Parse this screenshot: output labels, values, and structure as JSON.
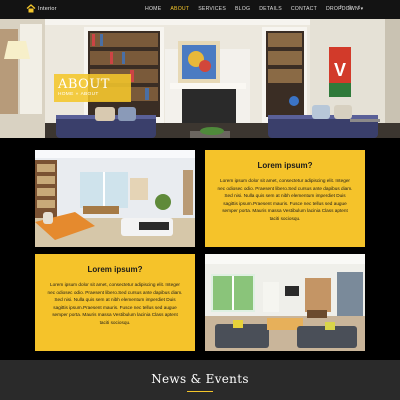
{
  "nav": {
    "logo_text": "Interior",
    "items": [
      {
        "label": "HOME",
        "active": false
      },
      {
        "label": "ABOUT",
        "active": true
      },
      {
        "label": "SERVICES",
        "active": false
      },
      {
        "label": "BLOG",
        "active": false
      },
      {
        "label": "DETAILS",
        "active": false
      },
      {
        "label": "CONTACT",
        "active": false
      },
      {
        "label": "DROPDOWN ▾",
        "active": false
      }
    ],
    "social": [
      "f",
      "◎",
      "t"
    ]
  },
  "hero": {
    "title": "ABOUT",
    "breadcrumb_home": "HOME",
    "breadcrumb_sep": "»",
    "breadcrumb_current": "ABOUT"
  },
  "cards": [
    {
      "title": "Lorem ipsum?",
      "text": "Lorem ipsum dolor sit amet, consectetur adipiscing elit. Integer nec odiosec odio. Praesent libero.Sed cursus ante dapibus diam. Sed nisi. Nulla quis sem at nibh elementum imperdiet Duis sagittis ipsum.Praesent mauris. Fusce nec tellus sed augue semper porta. Mauris massa Vestibulum lacinia Class aptent taciti sociosqu."
    },
    {
      "title": "Lorem ipsum?",
      "text": "Lorem ipsum dolor sit amet, consectetur adipiscing elit. Integer nec odiosec odio. Praesent libero.Sed cursus ante dapibus diam. Sed nisi. Nulla quis sem at nibh elementum imperdiet Duis sagittis ipsum.Praesent mauris. Fusce nec tellus sed augue semper porta. Mauris massa Vestibulum lacinia Class aptent taciti sociosqu."
    }
  ],
  "news": {
    "title": "News & Events"
  },
  "colors": {
    "accent": "#f4c62b",
    "nav_bg": "#131313",
    "page_bg": "#000000",
    "card_bg": "#f5c32a"
  }
}
